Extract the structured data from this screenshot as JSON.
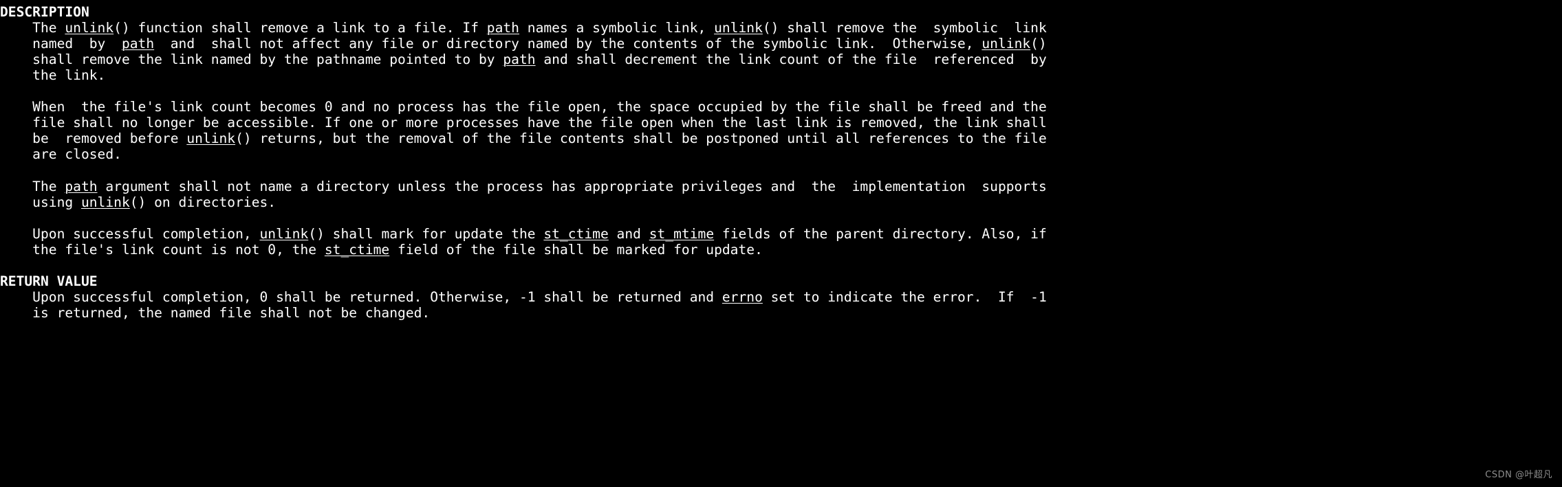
{
  "terminal": {
    "background_color": "#000000",
    "foreground_color": "#ffffff",
    "watermark": "CSDN @叶超凡"
  },
  "manpage": {
    "sections": [
      {
        "heading": "DESCRIPTION",
        "paragraphs": [
          {
            "lines": [
              "    The <u>unlink</u>() function shall remove a link to a file. If <u>path</u> names a symbolic link, <u>unlink</u>() shall remove the  symbolic  link",
              "    named  by  <u>path</u>  and  shall not affect any file or directory named by the contents of the symbolic link.  Otherwise, <u>unlink</u>()",
              "    shall remove the link named by the pathname pointed to by <u>path</u> and shall decrement the link count of the file  referenced  by",
              "    the link."
            ]
          },
          {
            "lines": [
              "    When  the file's link count becomes 0 and no process has the file open, the space occupied by the file shall be freed and the",
              "    file shall no longer be accessible. If one or more processes have the file open when the last link is removed, the link shall",
              "    be  removed before <u>unlink</u>() returns, but the removal of the file contents shall be postponed until all references to the file",
              "    are closed."
            ]
          },
          {
            "lines": [
              "    The <u>path</u> argument shall not name a directory unless the process has appropriate privileges and  the  implementation  supports",
              "    using <u>unlink</u>() on directories."
            ]
          },
          {
            "lines": [
              "    Upon successful completion, <u>unlink</u>() shall mark for update the <u>st_ctime</u> and <u>st_mtime</u> fields of the parent directory. Also, if",
              "    the file's link count is not 0, the <u>st_ctime</u> field of the file shall be marked for update."
            ]
          }
        ]
      },
      {
        "heading": "RETURN VALUE",
        "paragraphs": [
          {
            "lines": [
              "    Upon successful completion, 0 shall be returned. Otherwise, -1 shall be returned and <u>errno</u> set to indicate the error.  If  -1",
              "    is returned, the named file shall not be changed."
            ]
          }
        ]
      }
    ]
  }
}
